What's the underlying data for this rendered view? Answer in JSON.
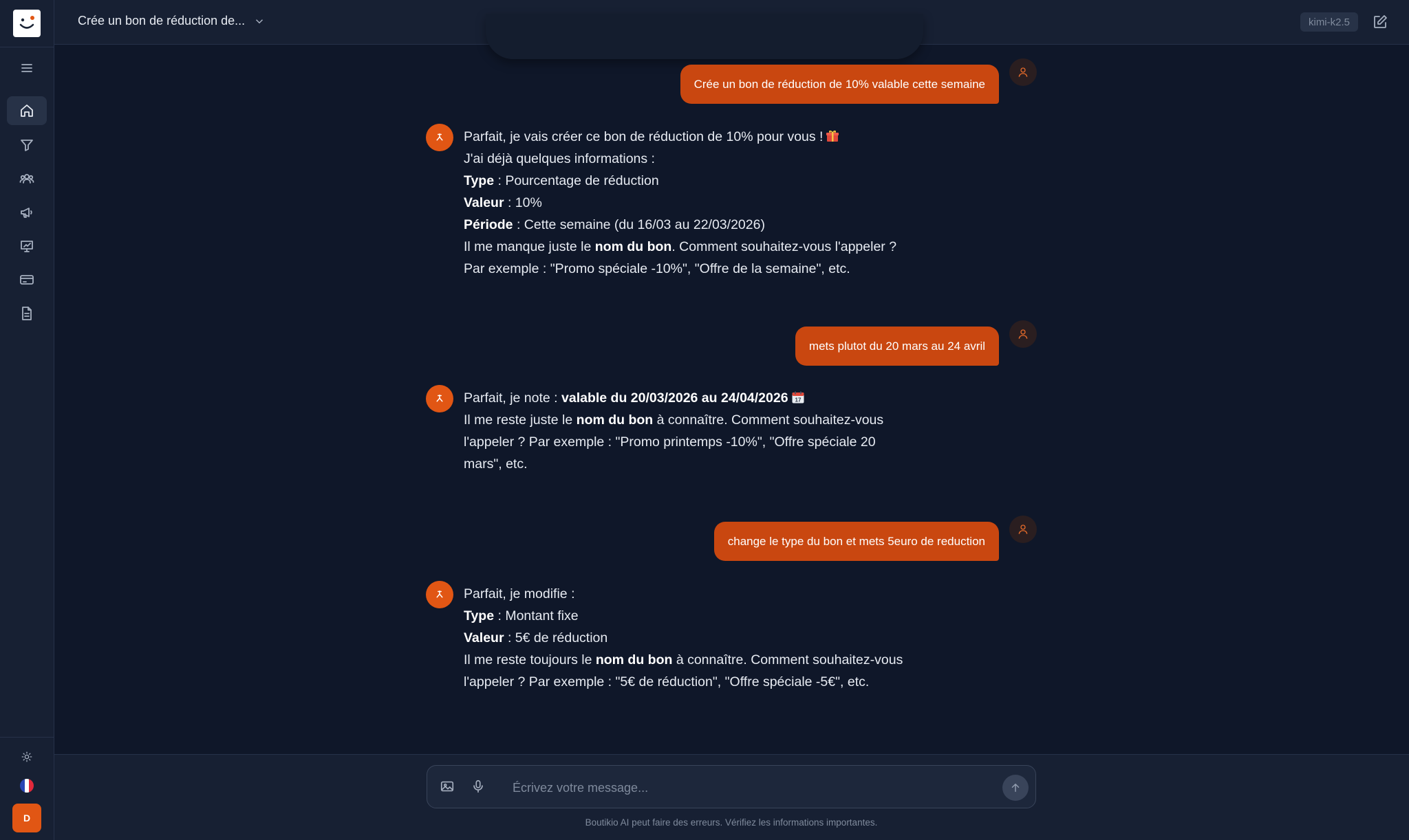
{
  "header": {
    "title": "Crée un bon de réduction de...",
    "model": "kimi-k2.5"
  },
  "sidebar": {
    "items": [
      {
        "name": "menu-icon"
      },
      {
        "name": "home-icon",
        "active": true
      },
      {
        "name": "filter-icon"
      },
      {
        "name": "customers-icon"
      },
      {
        "name": "megaphone-icon"
      },
      {
        "name": "analytics-icon"
      },
      {
        "name": "card-icon"
      },
      {
        "name": "document-icon"
      }
    ],
    "user_initial": "D"
  },
  "messages": [
    {
      "role": "user",
      "text": "Crée un bon de réduction de 10% valable cette semaine"
    },
    {
      "role": "assistant",
      "lines": [
        {
          "parts": [
            {
              "t": "Parfait, je vais créer ce bon de réduction de 10% pour vous !"
            }
          ],
          "emoji": "gift"
        },
        {
          "parts": [
            {
              "t": "J'ai déjà quelques informations :"
            }
          ]
        },
        {
          "parts": [
            {
              "t": "Type",
              "b": true
            },
            {
              "t": " : Pourcentage de réduction"
            }
          ]
        },
        {
          "parts": [
            {
              "t": "Valeur",
              "b": true
            },
            {
              "t": " : 10%"
            }
          ]
        },
        {
          "parts": [
            {
              "t": "Période",
              "b": true
            },
            {
              "t": " : Cette semaine (du 16/03 au 22/03/2026)"
            }
          ]
        },
        {
          "parts": [
            {
              "t": "Il me manque juste le "
            },
            {
              "t": "nom du bon",
              "b": true
            },
            {
              "t": ". Comment souhaitez-vous l'appeler ?"
            }
          ]
        },
        {
          "parts": [
            {
              "t": "Par exemple : \"Promo spéciale -10%\", \"Offre de la semaine\", etc."
            }
          ]
        }
      ]
    },
    {
      "role": "user",
      "text": "mets plutot du 20 mars au 24 avril"
    },
    {
      "role": "assistant",
      "lines": [
        {
          "parts": [
            {
              "t": "Parfait, je note : "
            },
            {
              "t": "valable du 20/03/2026 au 24/04/2026",
              "b": true
            }
          ],
          "emoji": "calendar"
        },
        {
          "parts": [
            {
              "t": "Il me reste juste le "
            },
            {
              "t": "nom du bon",
              "b": true
            },
            {
              "t": " à connaître. Comment souhaitez-vous"
            }
          ]
        },
        {
          "parts": [
            {
              "t": "l'appeler ? Par exemple : \"Promo printemps -10%\", \"Offre spéciale 20"
            }
          ]
        },
        {
          "parts": [
            {
              "t": "mars\", etc."
            }
          ]
        }
      ]
    },
    {
      "role": "user",
      "text": "change le type du bon et mets 5euro de reduction"
    },
    {
      "role": "assistant",
      "lines": [
        {
          "parts": [
            {
              "t": "Parfait, je modifie :"
            }
          ]
        },
        {
          "parts": [
            {
              "t": "Type",
              "b": true
            },
            {
              "t": " : Montant fixe"
            }
          ]
        },
        {
          "parts": [
            {
              "t": "Valeur",
              "b": true
            },
            {
              "t": " : 5€ de réduction"
            }
          ]
        },
        {
          "parts": [
            {
              "t": "Il me reste toujours le "
            },
            {
              "t": "nom du bon",
              "b": true
            },
            {
              "t": " à connaître. Comment souhaitez-vous"
            }
          ]
        },
        {
          "parts": [
            {
              "t": "l'appeler ? Par exemple : \"5€ de réduction\", \"Offre spéciale -5€\", etc."
            }
          ]
        }
      ]
    }
  ],
  "composer": {
    "placeholder": "Écrivez votre message...",
    "disclaimer": "Boutikio AI peut faire des erreurs. Vérifiez les informations importantes."
  },
  "colors": {
    "accent": "#e15614",
    "user_bubble": "#c94710",
    "background": "#0f1729",
    "panel": "#172033"
  }
}
